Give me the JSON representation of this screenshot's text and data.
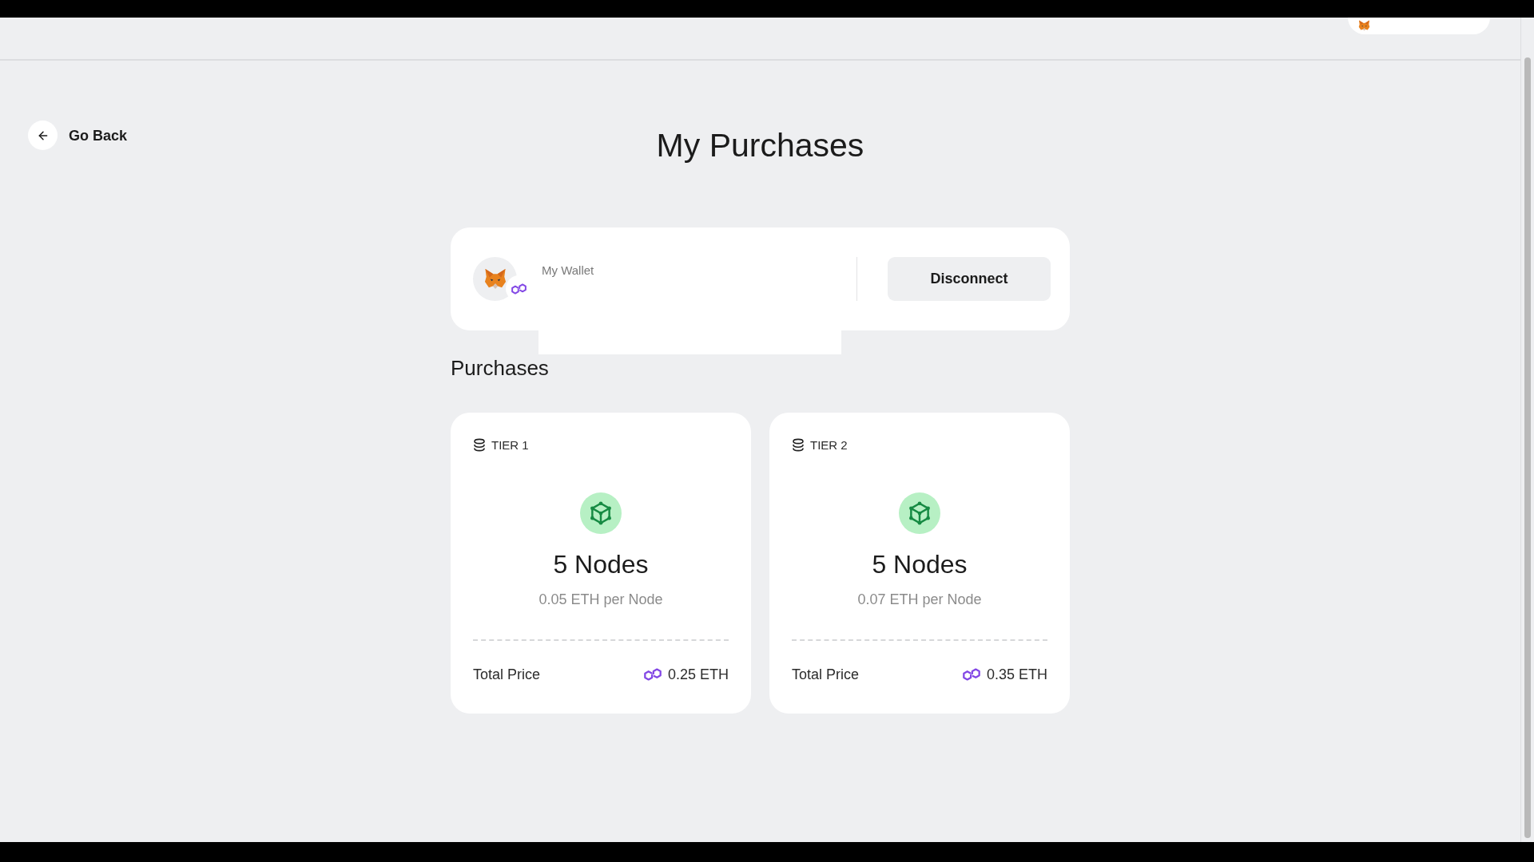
{
  "back_link": {
    "label": "Go Back"
  },
  "title": "My Purchases",
  "wallet": {
    "label": "My Wallet",
    "button": "Disconnect"
  },
  "purchases": {
    "heading": "Purchases",
    "items": [
      {
        "tier": "TIER 1",
        "nodes": "5 Nodes",
        "unit_price": "0.05 ETH per Node",
        "total_label": "Total Price",
        "total": "0.25 ETH"
      },
      {
        "tier": "TIER 2",
        "nodes": "5 Nodes",
        "unit_price": "0.07 ETH per Node",
        "total_label": "Total Price",
        "total": "0.35 ETH"
      }
    ]
  }
}
